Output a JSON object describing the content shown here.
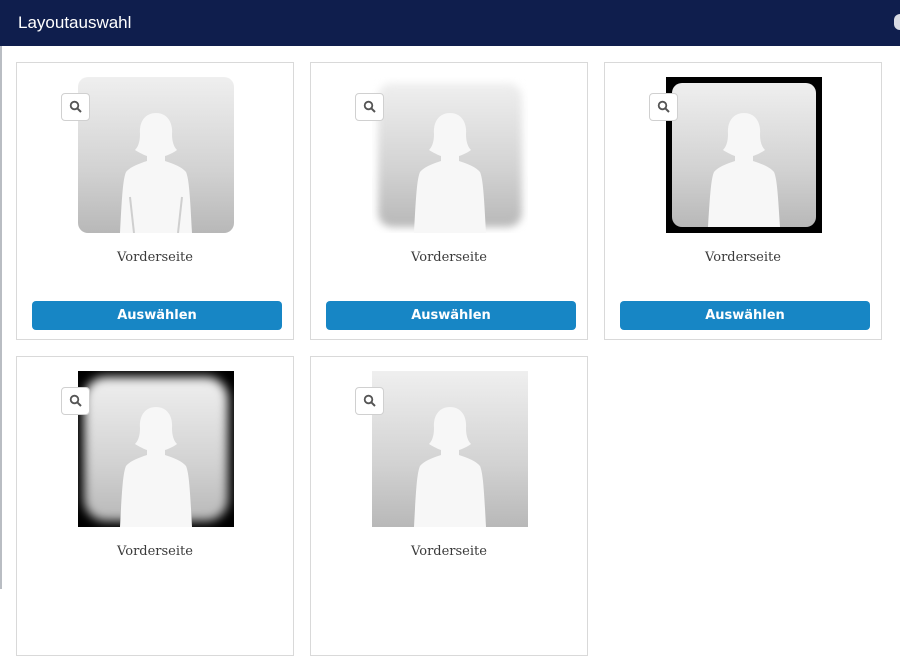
{
  "dialog": {
    "title": "Layoutauswahl"
  },
  "layouts": [
    {
      "style": "rounded",
      "caption": "Vorderseite",
      "button": "Auswählen"
    },
    {
      "style": "blur",
      "caption": "Vorderseite",
      "button": "Auswählen"
    },
    {
      "style": "black-border",
      "caption": "Vorderseite",
      "button": "Auswählen"
    },
    {
      "style": "black-vignette",
      "caption": "Vorderseite",
      "button": ""
    },
    {
      "style": "square",
      "caption": "Vorderseite",
      "button": ""
    }
  ],
  "icons": {
    "zoom": "magnifier-icon",
    "placeholder": "person-silhouette-icon",
    "close": "close-icon"
  },
  "colors": {
    "header": "#0f1e4d",
    "button": "#1786c5",
    "card_border": "#d9d9d9"
  }
}
